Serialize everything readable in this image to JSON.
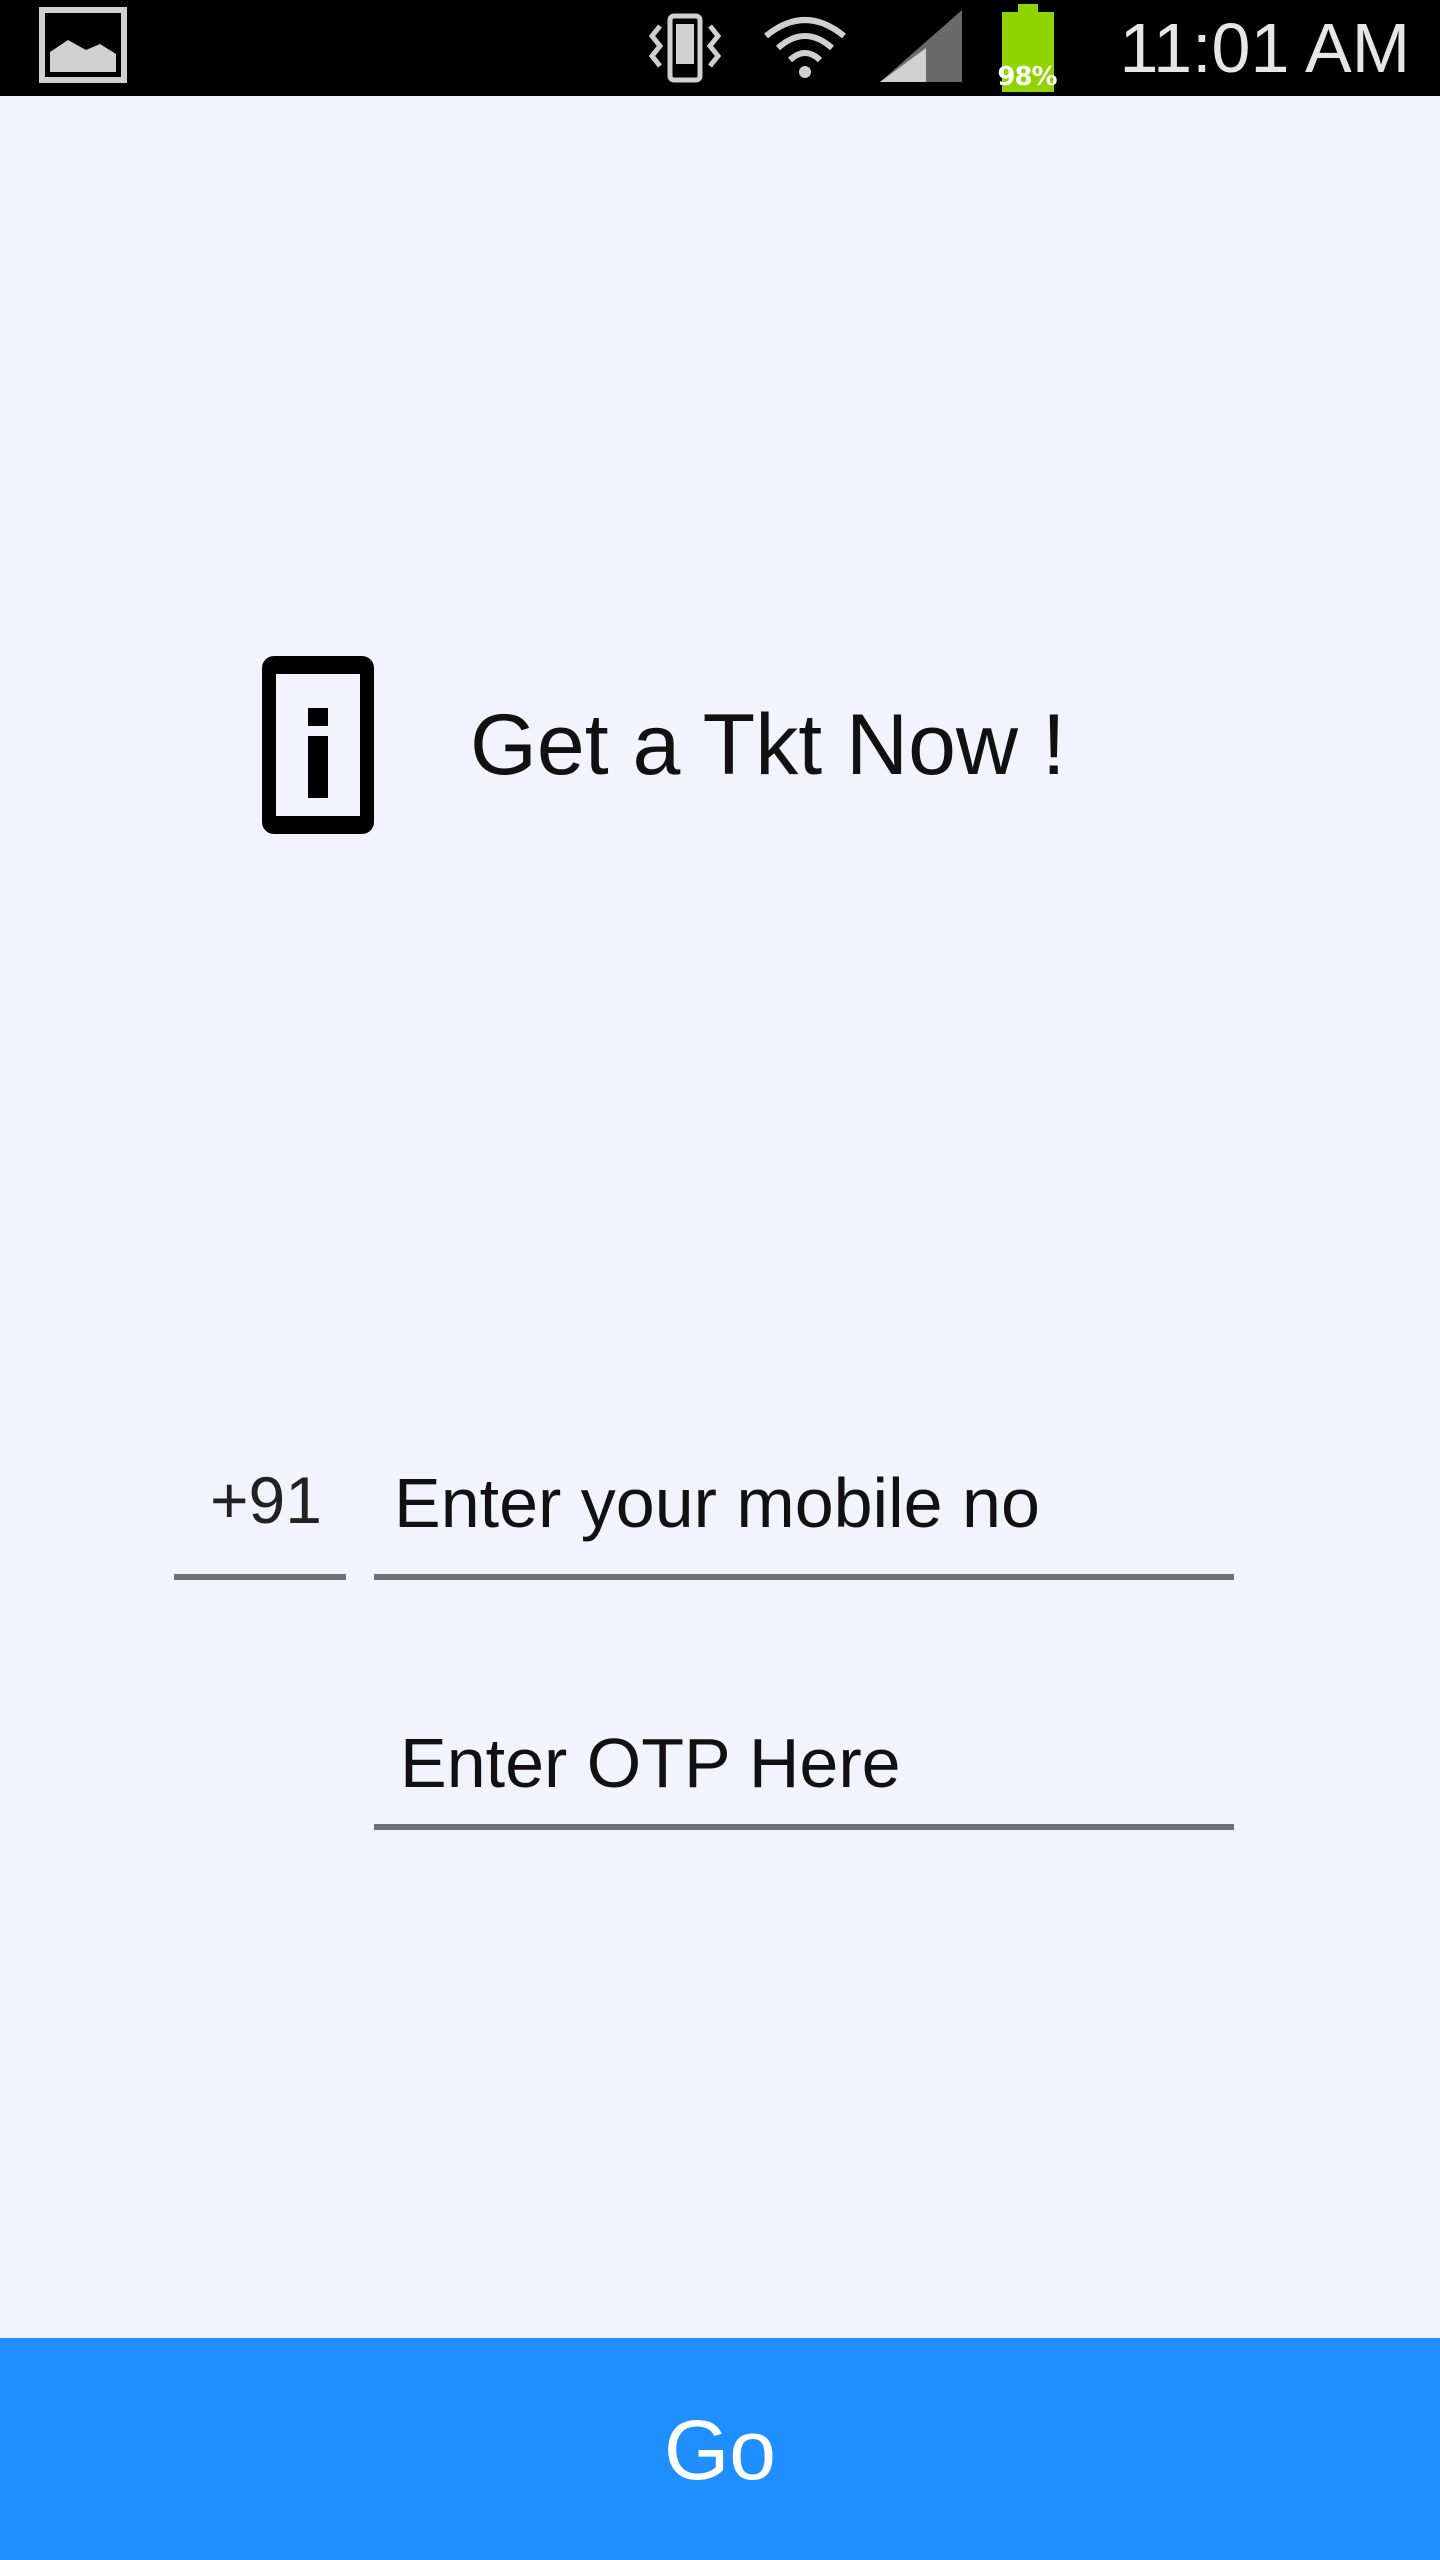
{
  "status_bar": {
    "time": "11:01 AM",
    "battery_percent": "98%",
    "icons": [
      "gallery-icon",
      "vibrate-icon",
      "wifi-icon",
      "signal-icon",
      "battery-icon"
    ],
    "battery_color": "#8fd400"
  },
  "header": {
    "icon": "phone-info-icon",
    "title": "Get a Tkt Now !"
  },
  "form": {
    "country_code": "+91",
    "mobile_placeholder": "Enter your mobile no",
    "mobile_value": "",
    "otp_placeholder": "Enter OTP Here",
    "otp_value": ""
  },
  "actions": {
    "go_label": "Go"
  },
  "colors": {
    "background": "#f1f4fd",
    "accent": "#1f8fff",
    "underline": "#6e7277"
  }
}
